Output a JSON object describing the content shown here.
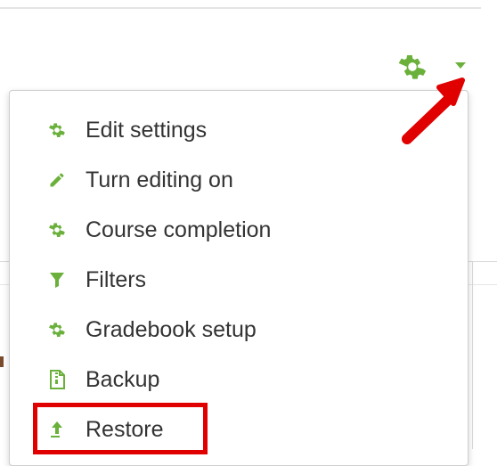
{
  "actions_menu": {
    "trigger_icon": "gear-icon",
    "items": [
      {
        "label": "Edit settings",
        "icon": "gear-icon"
      },
      {
        "label": "Turn editing on",
        "icon": "pencil-icon"
      },
      {
        "label": "Course completion",
        "icon": "gear-icon"
      },
      {
        "label": "Filters",
        "icon": "filter-icon"
      },
      {
        "label": "Gradebook setup",
        "icon": "gear-icon"
      },
      {
        "label": "Backup",
        "icon": "file-archive-icon"
      },
      {
        "label": "Restore",
        "icon": "upload-icon"
      }
    ]
  },
  "annotations": {
    "arrow_color": "#e00000",
    "highlight_color": "#e00000"
  },
  "colors": {
    "icon_green": "#6ab03b",
    "text": "#333333"
  }
}
